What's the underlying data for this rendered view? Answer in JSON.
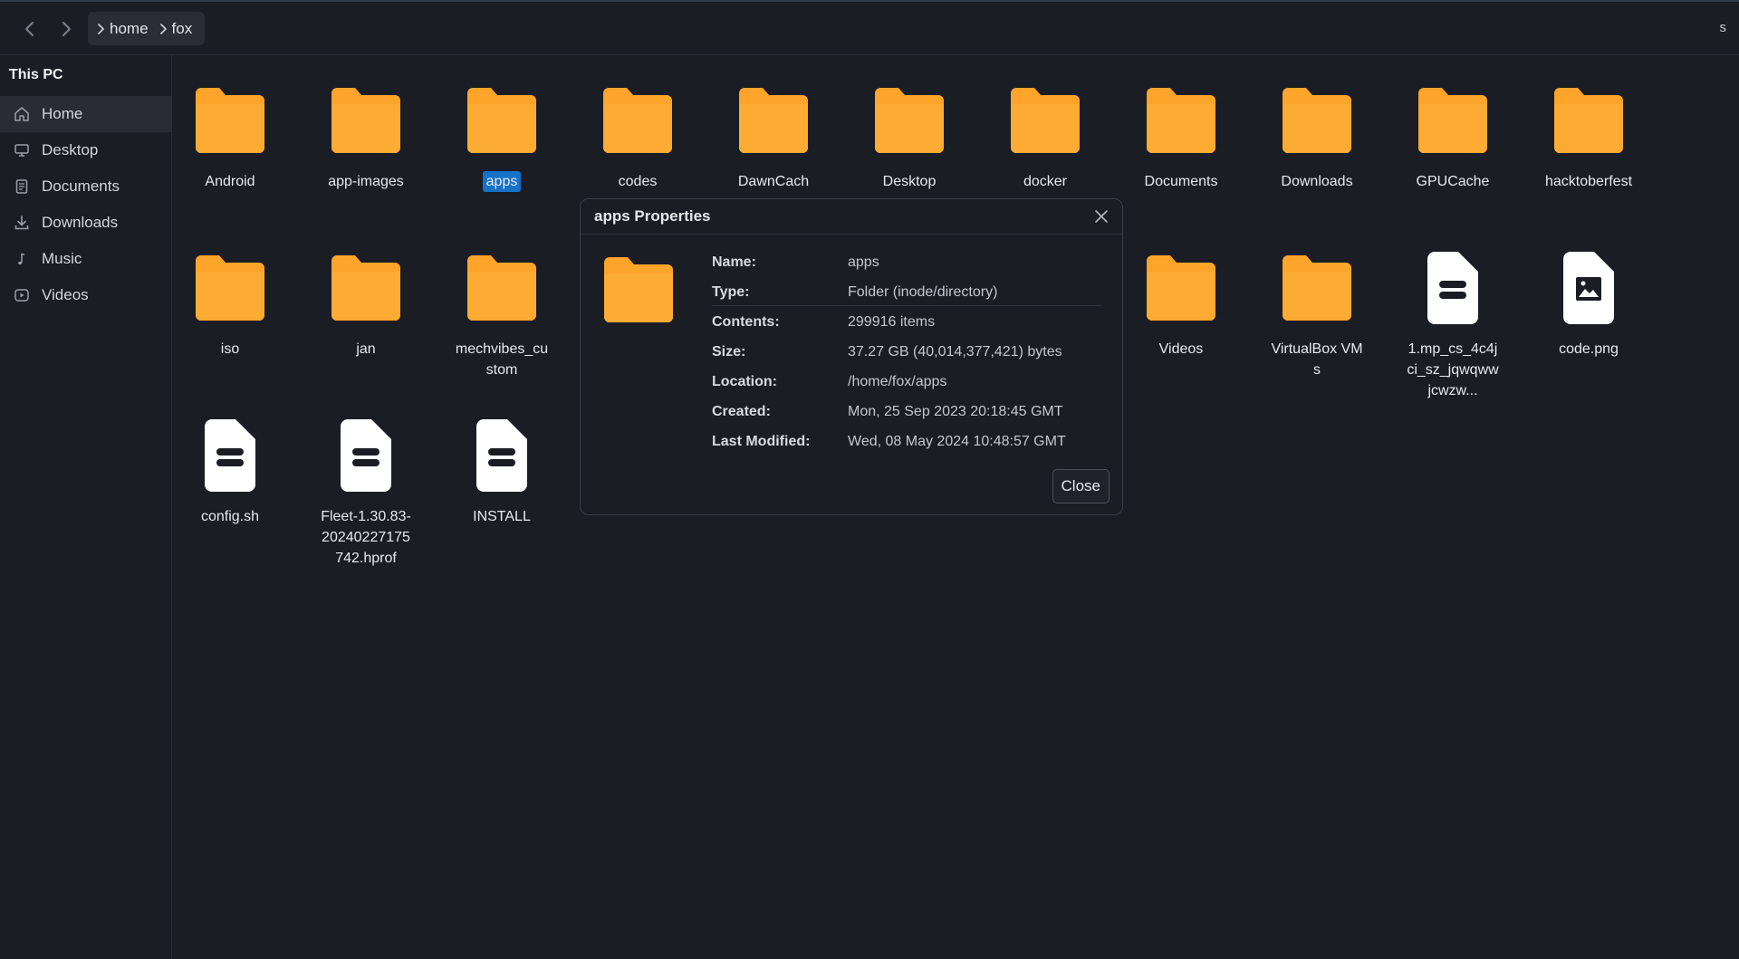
{
  "topbar": {
    "breadcrumb": [
      "home",
      "fox"
    ],
    "right_text": "s"
  },
  "sidebar": {
    "title": "This PC",
    "items": [
      {
        "label": "Home",
        "icon": "home-icon"
      },
      {
        "label": "Desktop",
        "icon": "monitor-icon"
      },
      {
        "label": "Documents",
        "icon": "document-icon"
      },
      {
        "label": "Downloads",
        "icon": "download-icon"
      },
      {
        "label": "Music",
        "icon": "music-note-icon"
      },
      {
        "label": "Videos",
        "icon": "video-icon"
      }
    ]
  },
  "files": [
    {
      "name": "Android",
      "type": "folder"
    },
    {
      "name": "app-images",
      "type": "folder"
    },
    {
      "name": "apps",
      "type": "folder",
      "selected": true
    },
    {
      "name": "codes",
      "type": "folder"
    },
    {
      "name": "DawnCach",
      "type": "folder"
    },
    {
      "name": "Desktop",
      "type": "folder"
    },
    {
      "name": "docker",
      "type": "folder"
    },
    {
      "name": "Documents",
      "type": "folder"
    },
    {
      "name": "Downloads",
      "type": "folder"
    },
    {
      "name": "GPUCache",
      "type": "folder"
    },
    {
      "name": "hacktoberfest",
      "type": "folder"
    },
    {
      "name": "iso",
      "type": "folder"
    },
    {
      "name": "jan",
      "type": "folder"
    },
    {
      "name": "mechvibes_custom",
      "type": "folder"
    },
    {
      "name": "Videos",
      "type": "folder"
    },
    {
      "name": "VirtualBox VMs",
      "type": "folder"
    },
    {
      "name": "1.mp_cs_4c4jci_sz_jqwqwwjcwzw...",
      "type": "file"
    },
    {
      "name": "code.png",
      "type": "image"
    },
    {
      "name": "config.sh",
      "type": "file"
    },
    {
      "name": "Fleet-1.30.83-20240227175742.hprof",
      "type": "file"
    },
    {
      "name": "INSTALL",
      "type": "file"
    }
  ],
  "dialog": {
    "title": "apps Properties",
    "props": [
      {
        "key": "Name:",
        "value": "apps"
      },
      {
        "key": "Type:",
        "value": "Folder (inode/directory)"
      },
      {
        "key": "Contents:",
        "value": "299916 items"
      },
      {
        "key": "Size:",
        "value": "37.27 GB (40,014,377,421) bytes"
      },
      {
        "key": "Location:",
        "value": "/home/fox/apps"
      },
      {
        "key": "Created:",
        "value": "Mon, 25 Sep 2023 20:18:45 GMT"
      },
      {
        "key": "Last Modified:",
        "value": "Wed, 08 May 2024 10:48:57 GMT"
      }
    ],
    "close_label": "Close"
  },
  "colors": {
    "background": "#1b1d25",
    "folder": "#fda52b",
    "selection": "#1572c8"
  }
}
